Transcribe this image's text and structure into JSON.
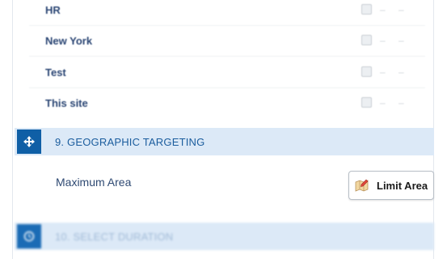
{
  "list": {
    "items": [
      {
        "name": "HR"
      },
      {
        "name": "New York"
      },
      {
        "name": "Test"
      },
      {
        "name": "This site"
      }
    ],
    "dash": "–"
  },
  "sections": {
    "geo": {
      "title": "9. GEOGRAPHIC TARGETING"
    },
    "duration": {
      "title": "10. SELECT DURATION"
    }
  },
  "geo_content": {
    "area_label": "Maximum Area",
    "limit_button_label": "Limit Area"
  },
  "colors": {
    "accent": "#0f5fa6",
    "section_bg": "#dce9f7"
  }
}
